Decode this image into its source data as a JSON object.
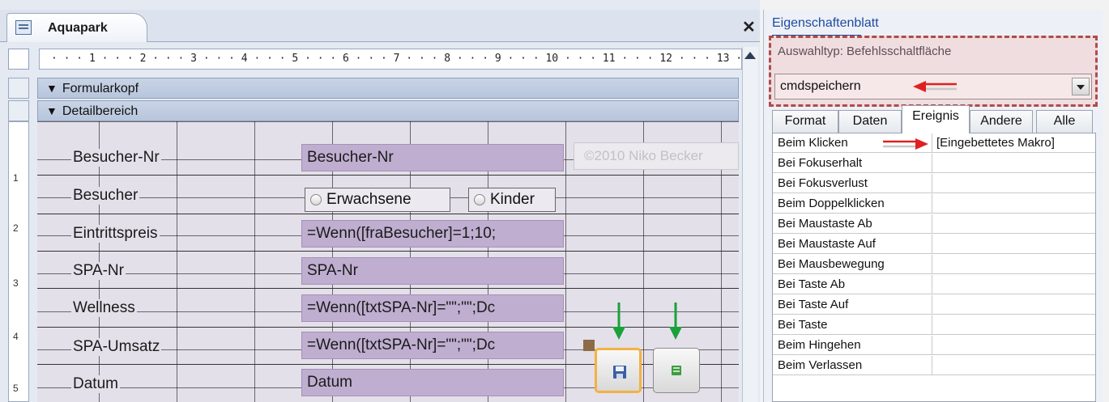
{
  "window": {
    "tab_title": "Aquapark",
    "close_label": "✕"
  },
  "ruler": {
    "horizontal": "· · · 1 · · · 2 · · · 3 · · · 4 · · · 5 · · · 6 · · · 7 · · · 8 · · · 9 · · · 10 · · · 11 · · · 12 · · · 13 ·",
    "vertical": [
      "1",
      "2",
      "3",
      "4",
      "5"
    ]
  },
  "sections": {
    "header": "Formularkopf",
    "detail": "Detailbereich"
  },
  "form": {
    "labels": [
      "Besucher-Nr",
      "Besucher",
      "Eintrittspreis",
      "SPA-Nr",
      "Wellness",
      "SPA-Umsatz",
      "Datum"
    ],
    "controls": {
      "besucher_nr": "Besucher-Nr",
      "eintrittspreis": "=Wenn([fraBesucher]=1;10;",
      "spa_nr": "SPA-Nr",
      "wellness": "=Wenn([txtSPA-Nr]=\"\";\"\";Dc",
      "spa_umsatz": "=Wenn([txtSPA-Nr]=\"\";\"\";Dc",
      "datum": "Datum"
    },
    "options": {
      "erwachsene": "Erwachsene",
      "kinder": "Kinder"
    },
    "copyright": "©2010 Niko Becker",
    "buttons": {
      "save_icon": "save-icon",
      "other_icon": "macro-icon"
    }
  },
  "property_sheet": {
    "title": "Eigenschaftenblatt",
    "selection_type": "Auswahltyp:  Befehlsschaltfläche",
    "selected_object": "cmdspeichern",
    "tabs": [
      "Format",
      "Daten",
      "Ereignis",
      "Andere",
      "Alle"
    ],
    "active_tab": "Ereignis",
    "rows": [
      {
        "name": "Beim Klicken",
        "value": "[Eingebettetes Makro]"
      },
      {
        "name": "Bei Fokuserhalt",
        "value": ""
      },
      {
        "name": "Bei Fokusverlust",
        "value": ""
      },
      {
        "name": "Beim Doppelklicken",
        "value": ""
      },
      {
        "name": "Bei Maustaste Ab",
        "value": ""
      },
      {
        "name": "Bei Maustaste Auf",
        "value": ""
      },
      {
        "name": "Bei Mausbewegung",
        "value": ""
      },
      {
        "name": "Bei Taste Ab",
        "value": ""
      },
      {
        "name": "Bei Taste Auf",
        "value": ""
      },
      {
        "name": "Bei Taste",
        "value": ""
      },
      {
        "name": "Beim Hingehen",
        "value": ""
      },
      {
        "name": "Beim Verlassen",
        "value": ""
      }
    ]
  },
  "colors": {
    "selection_border": "#b14b4b",
    "arrow_red": "#e02020",
    "arrow_green": "#1aa13a",
    "button_highlight": "#f4b142"
  }
}
